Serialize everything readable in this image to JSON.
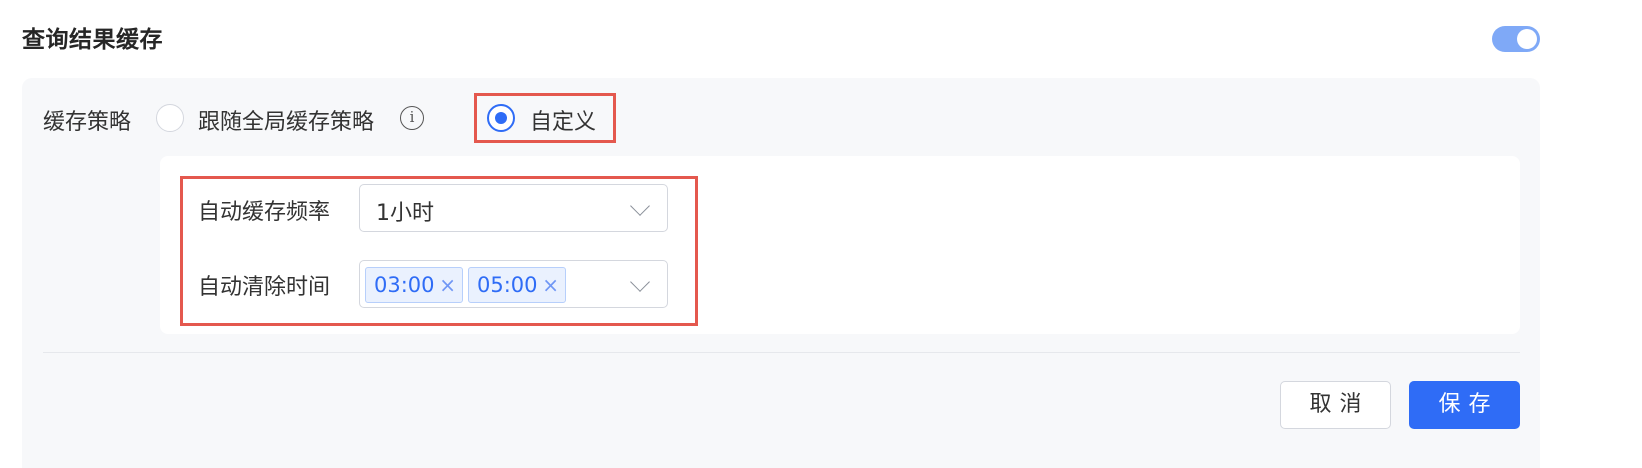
{
  "section": {
    "title": "查询结果缓存",
    "enabled": true
  },
  "strategy": {
    "label": "缓存策略",
    "options": [
      {
        "label": "跟随全局缓存策略",
        "selected": false,
        "has_info_icon": true
      },
      {
        "label": "自定义",
        "selected": true
      }
    ]
  },
  "custom": {
    "frequency": {
      "label": "自动缓存频率",
      "value": "1小时"
    },
    "clear_time": {
      "label": "自动清除时间",
      "tags": [
        "03:00",
        "05:00"
      ],
      "remove_icon": "×"
    }
  },
  "info_icon_glyph": "i",
  "actions": {
    "cancel_label": "取消",
    "save_label": "保存"
  },
  "colors": {
    "primary": "#2f6cf6",
    "toggle_on": "#7fa9f7",
    "highlight_border": "#e4584e",
    "panel_bg": "#f7f8fa"
  }
}
